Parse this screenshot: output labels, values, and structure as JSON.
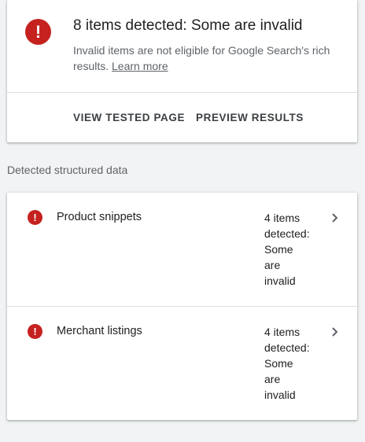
{
  "summary": {
    "icon": "error-icon",
    "title": "8 items detected: Some are invalid",
    "subtitle": "Invalid items are not eligible for Google Search's rich results.",
    "learn_more": "Learn more",
    "actions": {
      "view_tested_page": "VIEW TESTED PAGE",
      "preview_results": "PREVIEW RESULTS"
    }
  },
  "section": {
    "label": "Detected structured data"
  },
  "items": [
    {
      "name": "Product snippets",
      "status_lines": [
        "4 items",
        "detected:",
        "Some",
        "are",
        "invalid"
      ],
      "icon": "error-icon"
    },
    {
      "name": "Merchant listings",
      "status_lines": [
        "4 items",
        "detected:",
        "Some",
        "are",
        "invalid"
      ],
      "icon": "error-icon"
    }
  ],
  "colors": {
    "error": "#c5221f",
    "background": "#f1f3f4",
    "card": "#ffffff",
    "text_primary": "#202124",
    "text_secondary": "#5f6368"
  }
}
